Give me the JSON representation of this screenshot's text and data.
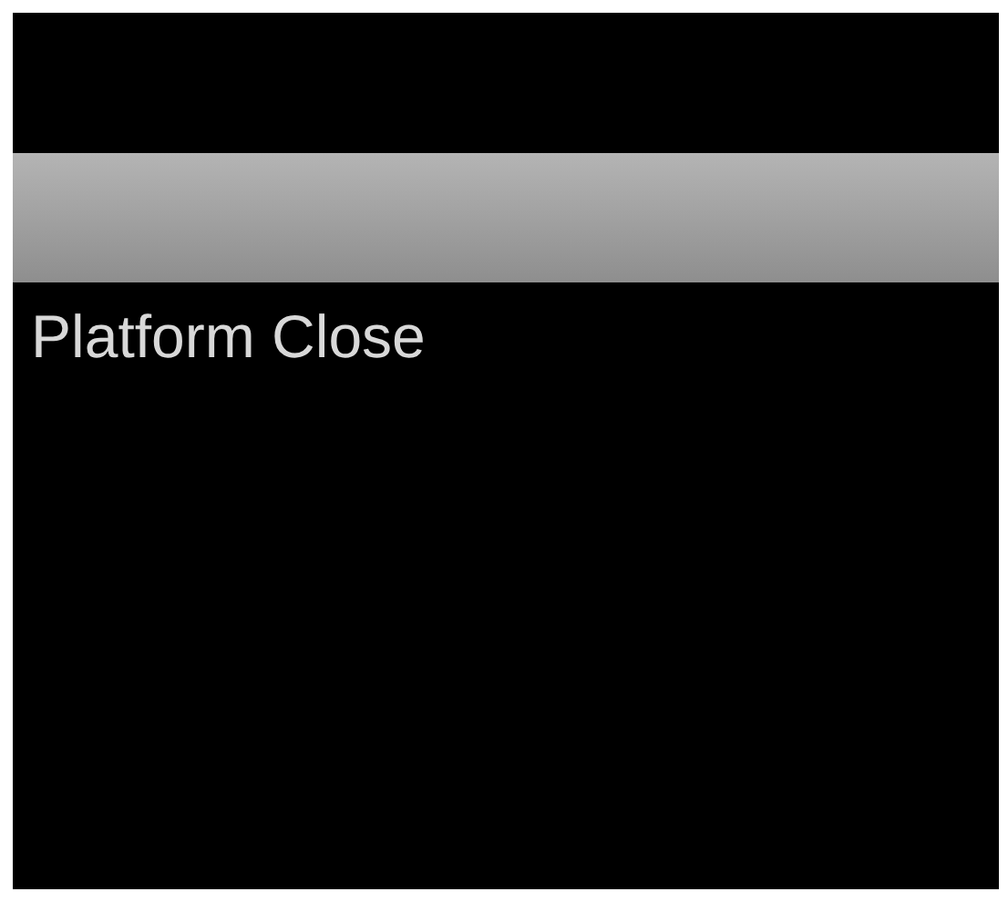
{
  "items": [
    {
      "label": "Platform Close",
      "selected": false
    }
  ]
}
